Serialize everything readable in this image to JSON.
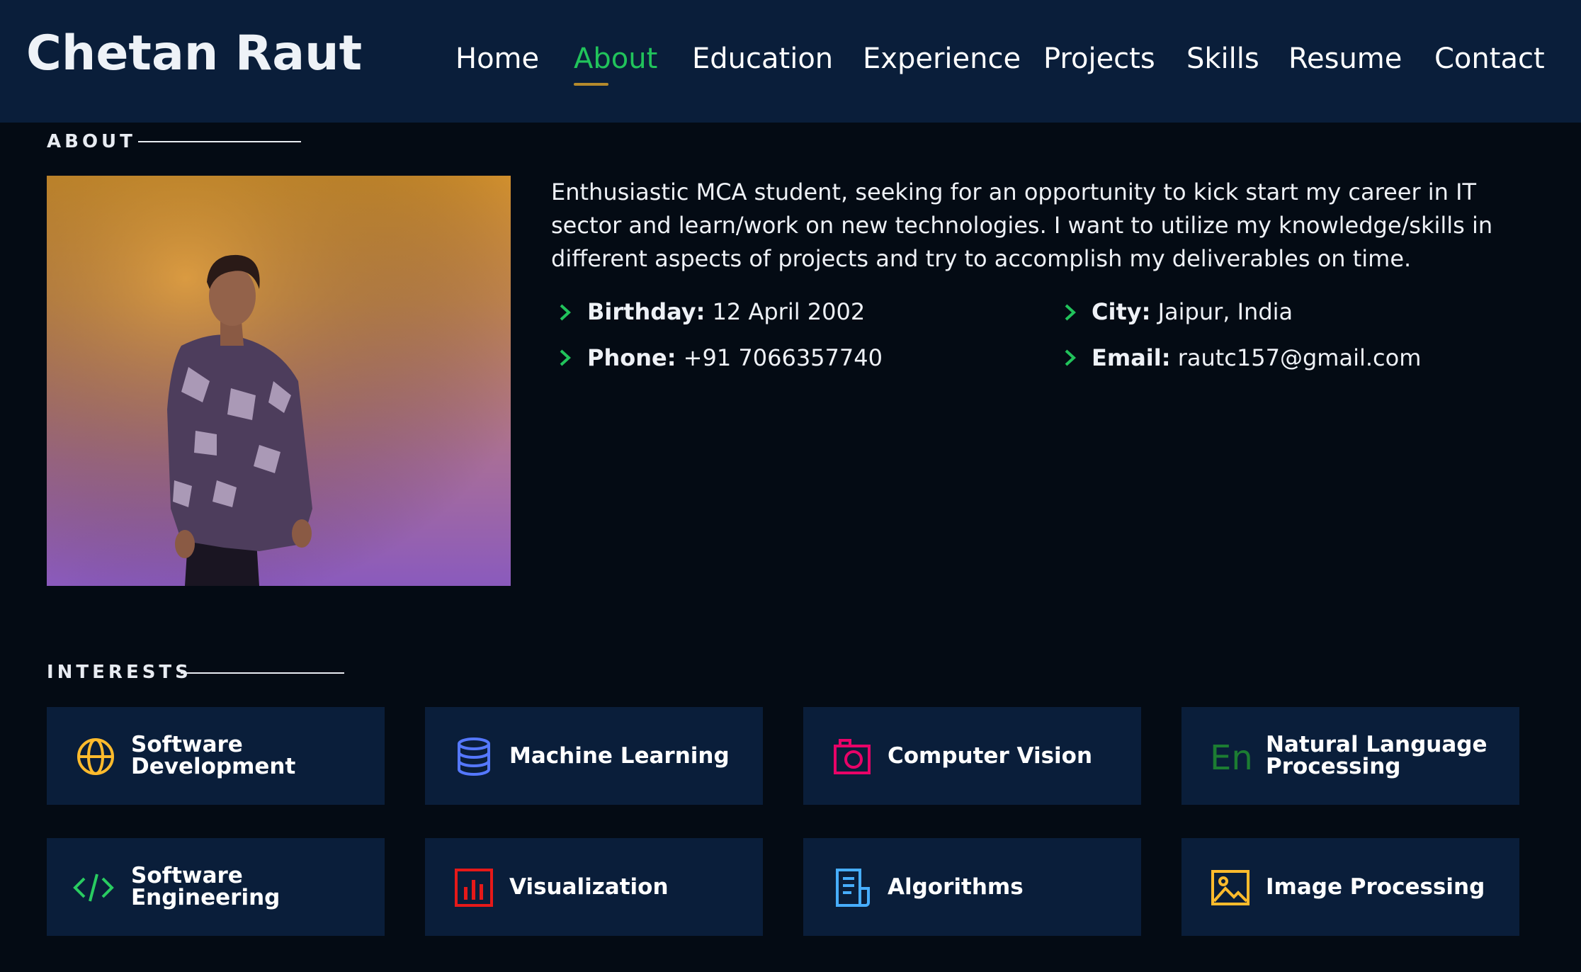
{
  "header": {
    "logo": "Chetan Raut",
    "nav": [
      "Home",
      "About",
      "Education",
      "Experience",
      "Projects",
      "Skills",
      "Resume",
      "Contact"
    ],
    "active_nav": "About"
  },
  "about": {
    "title": "ABOUT",
    "bio": "Enthusiastic MCA student, seeking for an opportunity to kick start my career in IT sector and learn/work on new technologies. I want to utilize my knowledge/skills in different aspects of projects and try to accomplish my deliverables on time.",
    "details": [
      {
        "label": "Birthday:",
        "value": "12 April 2002"
      },
      {
        "label": "City:",
        "value": "Jaipur, India"
      },
      {
        "label": "Phone:",
        "value": "+91 7066357740"
      },
      {
        "label": "Email:",
        "value": "rautc157@gmail.com"
      }
    ]
  },
  "interests": {
    "title": "INTERESTS",
    "items": [
      {
        "label": "Software Development",
        "icon": "globe-icon",
        "color": "#ffbb2c"
      },
      {
        "label": "Machine Learning",
        "icon": "database-icon",
        "color": "#5578ff"
      },
      {
        "label": "Computer Vision",
        "icon": "camera-icon",
        "color": "#e80368"
      },
      {
        "label": "Natural Language Processing",
        "icon": "language-icon",
        "color": "#1c7d32"
      },
      {
        "label": "Software Engineering",
        "icon": "code-icon",
        "color": "#29cc61"
      },
      {
        "label": "Visualization",
        "icon": "bar-chart-icon",
        "color": "#e61919"
      },
      {
        "label": "Algorithms",
        "icon": "document-icon",
        "color": "#47aeff"
      },
      {
        "label": "Image Processing",
        "icon": "image-icon",
        "color": "#ffbb2c"
      }
    ]
  },
  "colors": {
    "accent": "#21c35b",
    "header_bg": "#0a1e3a",
    "page_bg": "#040b14",
    "underline": "#b58a2c"
  }
}
